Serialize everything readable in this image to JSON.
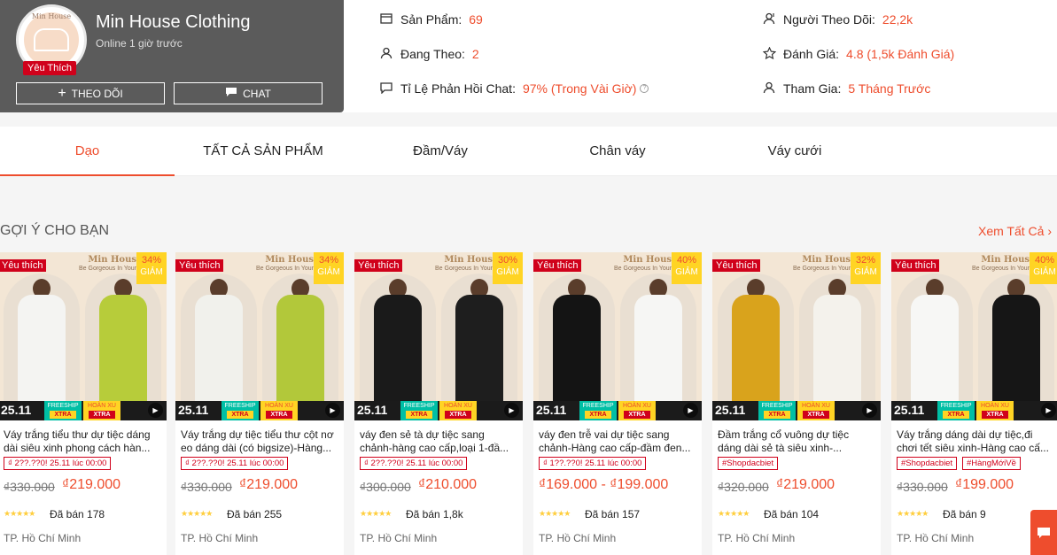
{
  "shop": {
    "name": "Min House Clothing",
    "online": "Online 1 giờ trước",
    "favorite_badge": "Yêu Thích",
    "logo_text": "Min House",
    "follow_label": "THEO DÕI",
    "chat_label": "CHAT"
  },
  "stats": {
    "products_label": "Sản Phẩm:",
    "products_value": "69",
    "following_label": "Đang Theo:",
    "following_value": "2",
    "chat_label": "Tỉ Lệ Phản Hồi Chat:",
    "chat_value": "97% (Trong Vài Giờ)",
    "followers_label": "Người Theo Dõi:",
    "followers_value": "22,2k",
    "rating_label": "Đánh Giá:",
    "rating_value": "4.8 (1,5k Đánh Giá)",
    "joined_label": "Tham Gia:",
    "joined_value": "5 Tháng Trước"
  },
  "tabs": [
    "Dạo",
    "TẤT CẢ SẢN PHẨM",
    "Đầm/Váy",
    "Chân váy",
    "Váy cưới"
  ],
  "section": {
    "title": "GỢI Ý CHO BẠN",
    "see_all": "Xem Tất Cả"
  },
  "common": {
    "fav": "Yêu thích",
    "brand": "Min Hous",
    "brand_sub": "Be Gorgeous In Your",
    "date": "25.11",
    "freeship": "FREESHIP",
    "hoanxu": "HOÀN XU",
    "xtra": "XTRA",
    "giam": "GIẢM"
  },
  "products": [
    {
      "name": "Váy trắng tiểu thư dự tiệc dáng dài siêu xinh phong cách hàn...",
      "discount": "34%",
      "tags": [
        "₫ 2??.??0! 25.11 lúc 00:00"
      ],
      "price_old": "₫330.000",
      "price_new": "₫219.000",
      "sold": "Đã bán 178",
      "location": "TP. Hồ Chí Minh",
      "rating": 5,
      "colors": [
        "#f4f4f2",
        "#b7cc3a"
      ]
    },
    {
      "name": "Váy trắng dự tiệc tiểu thư cột nơ eo dáng dài (có bigsize)-Hàng...",
      "discount": "34%",
      "tags": [
        "₫ 2??.??0! 25.11 lúc 00:00"
      ],
      "price_old": "₫330.000",
      "price_new": "₫219.000",
      "sold": "Đã bán 255",
      "location": "TP. Hồ Chí Minh",
      "rating": 5,
      "colors": [
        "#f1f1ec",
        "#b2c83a"
      ]
    },
    {
      "name": "váy đen sẻ tà dự tiệc sang chảnh-hàng cao cấp,loại 1-đầ...",
      "discount": "30%",
      "tags": [
        "₫ 2??.??0! 25.11 lúc 00:00"
      ],
      "price_old": "₫300.000",
      "price_new": "₫210.000",
      "sold": "Đã bán 1,8k",
      "location": "TP. Hồ Chí Minh",
      "rating": 5,
      "colors": [
        "#1a1a1a",
        "#1e1e1e"
      ]
    },
    {
      "name": "váy đen trễ vai dự tiệc sang chảnh-Hàng cao cấp-đầm đen...",
      "discount": "40%",
      "tags": [
        "₫ 1??.??0! 25.11 lúc 00:00"
      ],
      "price_old": "",
      "price_new": "₫169.000 - ₫199.000",
      "sold": "Đã bán 157",
      "location": "TP. Hồ Chí Minh",
      "rating": 5,
      "colors": [
        "#141414",
        "#f6f6f4"
      ]
    },
    {
      "name": "Đầm trắng cổ vuông dự tiệc dáng dài sẻ tà siêu xinh-...",
      "discount": "32%",
      "tags": [
        "#Shopdacbiet"
      ],
      "price_old": "₫320.000",
      "price_new": "₫219.000",
      "sold": "Đã bán 104",
      "location": "TP. Hồ Chí Minh",
      "rating": 5,
      "colors": [
        "#d9a31c",
        "#f4f2ec"
      ]
    },
    {
      "name": "Váy trắng dáng dài dự tiệc,đi chơi tết siêu xinh-Hàng cao cấ...",
      "discount": "40%",
      "tags": [
        "#Shopdacbiet",
        "#HàngMớiVề"
      ],
      "price_old": "₫330.000",
      "price_new": "₫199.000",
      "sold": "Đã bán 9",
      "location": "TP. Hồ Chí Minh",
      "rating": 5,
      "colors": [
        "#f7f7f5",
        "#161616"
      ]
    }
  ]
}
